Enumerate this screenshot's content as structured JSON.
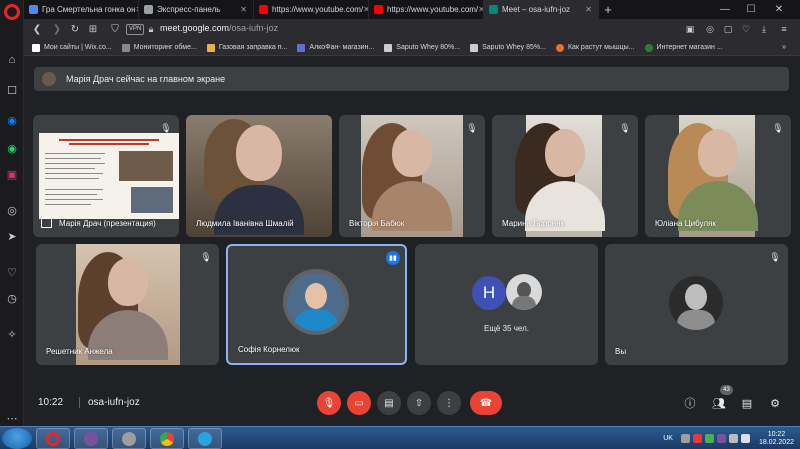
{
  "browser": {
    "tabs": [
      {
        "title": "Гра Смертельна гонка он",
        "favicon_color": "#4c8bf5",
        "active": false
      },
      {
        "title": "Экспресс-панель",
        "favicon_color": "#9aa0a6",
        "active": false
      },
      {
        "title": "https://www.youtube.com/",
        "favicon_color": "#ff0000",
        "active": false
      },
      {
        "title": "https://www.youtube.com/",
        "favicon_color": "#ff0000",
        "active": false
      },
      {
        "title": "Meet – osa-iufn-joz",
        "favicon_color": "#00897b",
        "active": true
      }
    ],
    "new_tab": "+",
    "vpn_label": "VPN",
    "url_domain": "meet.google.com",
    "url_path": "/osa-iufn-joz",
    "bookmarks": [
      {
        "label": "Мои сайты | Wix.co...",
        "color": "#ffffff"
      },
      {
        "label": "Мониторинг обме...",
        "color": "#888888"
      },
      {
        "label": "Газовая заправка п...",
        "color": "#e8b04b"
      },
      {
        "label": "АлкоФан- магазин...",
        "color": "#5b6fd6"
      },
      {
        "label": "Saputo Whey 80%...",
        "color": "#cccccc"
      },
      {
        "label": "Saputo Whey 85%...",
        "color": "#cccccc"
      },
      {
        "label": "Как растут мышцы...",
        "color": "#e8702a"
      },
      {
        "label": "Интернет магазин ...",
        "color": "#2e7d32"
      }
    ]
  },
  "meet": {
    "banner": "Марія Драч сейчас на главном экране",
    "participants_row1": [
      {
        "name": "Марія Драч (презентация)"
      },
      {
        "name": "Людмила Іванівна Шмалій"
      },
      {
        "name": "Вікторія Бабюк"
      },
      {
        "name": "Марина Бороняк"
      },
      {
        "name": "Юліана Цибуляк"
      }
    ],
    "participants_row2": [
      {
        "name": "Решетник Анжела"
      },
      {
        "name": "Софія Корнелюк"
      },
      {
        "name": "",
        "more_label": "Ещё 35 чел.",
        "avatar_letter": "H"
      },
      {
        "name": "Вы"
      }
    ]
  },
  "controls": {
    "time": "10:22",
    "meeting_code": "osa-iufn-joz",
    "people_count": "43"
  },
  "taskbar": {
    "lang": "UK",
    "clock_time": "10:22",
    "clock_date": "18.02.2022"
  }
}
